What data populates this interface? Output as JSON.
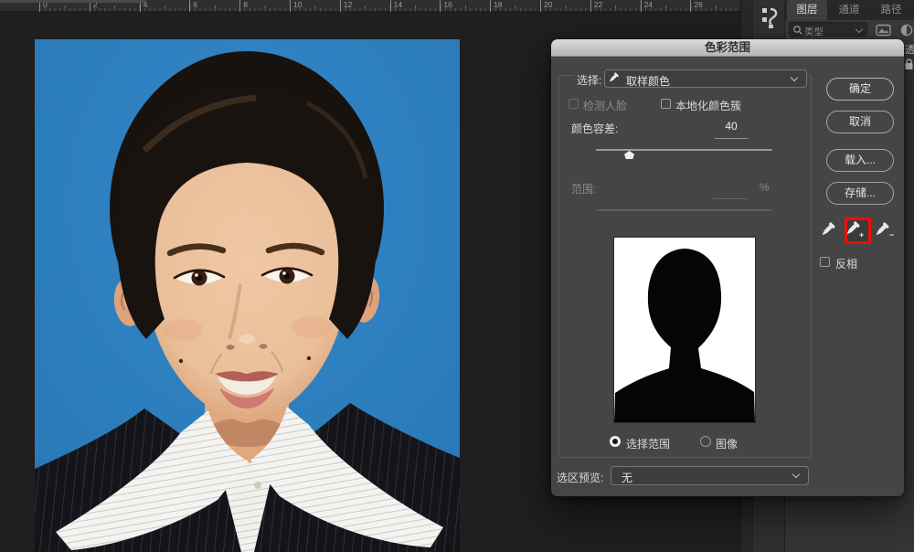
{
  "colors": {
    "photo_background_blue": "#2e80c1",
    "highlight_red": "#f20c05"
  },
  "ruler": {
    "numbers": [
      "0",
      "2",
      "4",
      "6",
      "8",
      "10",
      "12",
      "14",
      "16",
      "18",
      "20",
      "22",
      "24",
      "26"
    ]
  },
  "layers_panel": {
    "tabs": [
      {
        "label": "图层"
      },
      {
        "label": "通道"
      },
      {
        "label": "路径"
      }
    ],
    "filter_label": "类型",
    "opacity_fragment": "透"
  },
  "dialog": {
    "title": "色彩范围",
    "select": {
      "label": "选择:",
      "value": "取样颜色"
    },
    "checkboxes": {
      "detect_faces": "检测人脸",
      "localized": "本地化颜色簇"
    },
    "fuzziness": {
      "label": "颜色容差:",
      "value": "40"
    },
    "range": {
      "label": "范围:",
      "unit": "%"
    },
    "preview_toggle": {
      "selection": "选择范围",
      "image": "图像"
    },
    "selection_preview": {
      "label": "选区预览:",
      "value": "无"
    },
    "invert": "反相",
    "buttons": {
      "ok": "确定",
      "cancel": "取消",
      "load": "载入...",
      "save": "存储..."
    }
  }
}
